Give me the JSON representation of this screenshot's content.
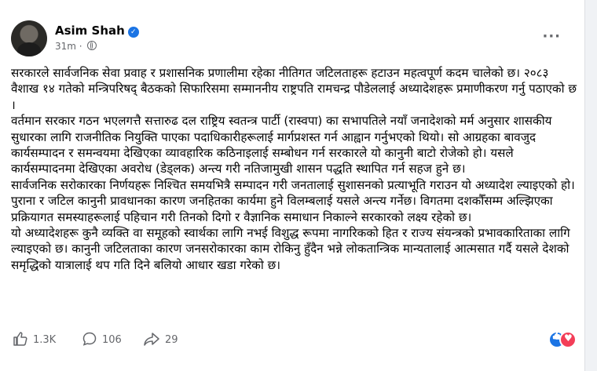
{
  "post": {
    "author": "Asim Shah",
    "time": "31m",
    "paragraphs": [
      "सरकारले सार्वजनिक सेवा प्रवाह र प्रशासनिक प्रणालीमा रहेका नीतिगत जटिलताहरू हटाउन महत्वपूर्ण कदम चालेको छ। २०८३ वैशाख १४ गतेको मन्त्रिपरिषद् बैठकको सिफारिसमा सम्माननीय राष्ट्रपति रामचन्द्र पौडेललाई अध्यादेशहरू प्रमाणीकरण गर्नु पठाएको छ ।",
      "वर्तमान सरकार गठन भएलगत्तै सत्तारुढ दल राष्ट्रिय स्वतन्त्र पार्टी (रास्वपा) का सभापतिले नयाँ जनादेशको मर्म अनुसार शासकीय सुधारका लागि राजनीतिक नियुक्ति पाएका पदाधिकारीहरूलाई मार्गप्रशस्त गर्न आह्वान गर्नुभएको थियो। सो आग्रहका बावजुद कार्यसम्पादन र समन्वयमा देखिएका व्यावहारिक कठिनाइलाई सम्बोधन गर्न सरकारले यो कानुनी बाटो रोजेको हो। यसले कार्यसम्पादनमा देखिएका अवरोध (डेड्लक) अन्त्य गरी नतिजामुखी शासन पद्धति स्थापित गर्न सहज हुने छ।",
      "सार्वजनिक सरोकारका निर्णयहरू निश्चित समयभित्रै सम्पादन गरी जनतालाई सुशासनको प्रत्याभूति गराउन यो अध्यादेश ल्याइएको हो। पुराना र जटिल कानुनी प्रावधानका कारण जनहितका कार्यमा हुने विलम्बलाई यसले अन्त्य गर्नेछ। विगतमा दशकौँसम्म अल्झिएका प्रक्रियागत समस्याहरूलाई पहिचान गरी तिनको दिगो र वैज्ञानिक समाधान निकाल्ने सरकारको लक्ष्य रहेको छ।",
      "यो अध्यादेशहरू कुनै व्यक्ति वा समूहको स्वार्थका लागि नभई विशुद्ध रूपमा नागरिकको हित र राज्य संयन्त्रको प्रभावकारिताका लागि ल्याइएको छ। कानुनी जटिलताका कारण जनसरोकारका काम रोकिनु हुँदैन भन्ने लोकतान्त्रिक मान्यतालाई आत्मसात गर्दै यसले देशको समृद्धिको यात्रालाई थप गति दिने बलियो आधार खडा गरेको छ।"
    ],
    "likes": "1.3K",
    "comments": "106",
    "shares": "29"
  },
  "colors": {
    "secondary_text": "#65676b",
    "brand_blue": "#1b74e4",
    "love_red": "#f33e58"
  }
}
